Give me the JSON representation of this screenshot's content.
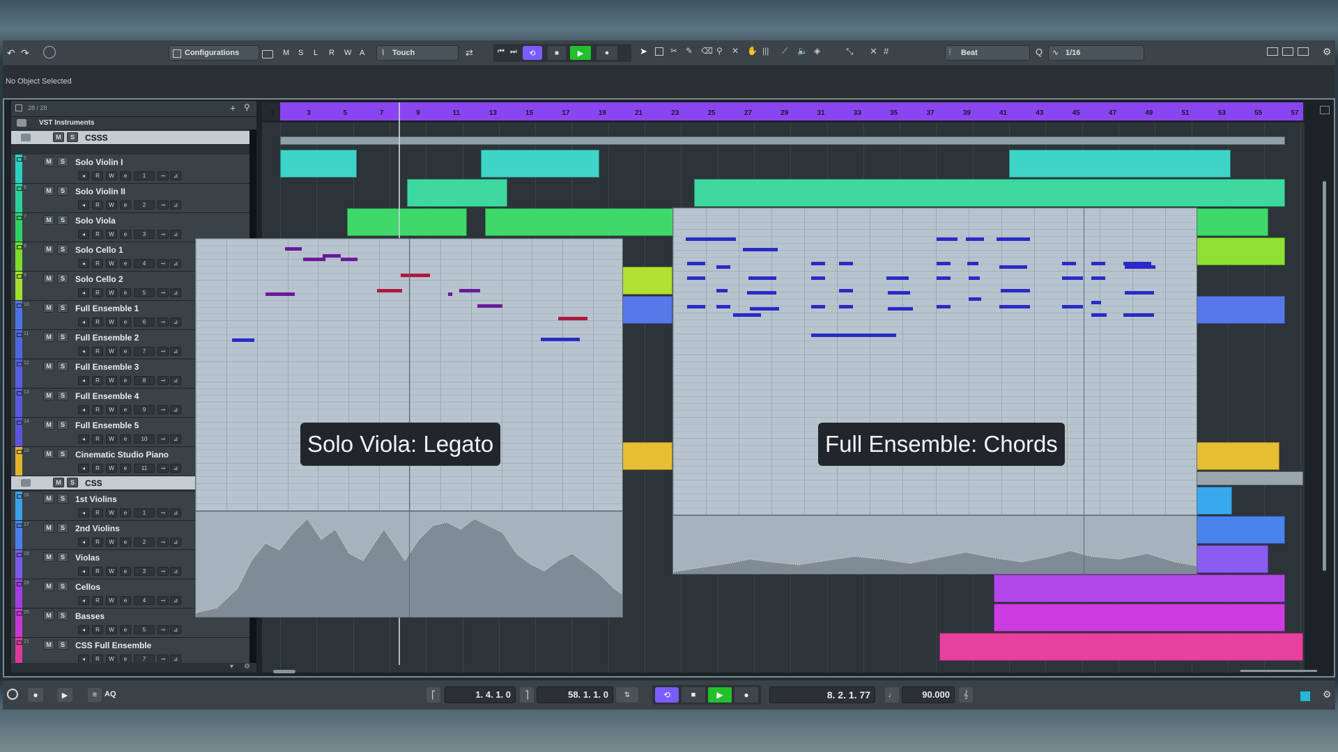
{
  "toolbar": {
    "configurations_label": "Configurations",
    "automation_mode": "Touch",
    "mode_buttons": [
      "M",
      "S",
      "L",
      "R",
      "W",
      "A"
    ],
    "grid_type": "Beat",
    "quantize": "1/16"
  },
  "info_line": {
    "text": "No Object Selected"
  },
  "track_list": {
    "count": "28 / 28",
    "folder_title": "VST Instruments",
    "tracks": [
      {
        "num": "",
        "name": "CSSS",
        "color": "#9ca7ae",
        "channel": ""
      },
      {
        "num": "5",
        "name": "Solo Violin I",
        "color": "#2ccfc0",
        "channel": "1"
      },
      {
        "num": "6",
        "name": "Solo Violin II",
        "color": "#2ccf9a",
        "channel": "2"
      },
      {
        "num": "7",
        "name": "Solo Viola",
        "color": "#2fd262",
        "channel": "3"
      },
      {
        "num": "8",
        "name": "Solo Cello 1",
        "color": "#7bdc2c",
        "channel": "4"
      },
      {
        "num": "9",
        "name": "Solo Cello 2",
        "color": "#a7dd2c",
        "channel": "5"
      },
      {
        "num": "10",
        "name": "Full Ensemble 1",
        "color": "#4e74e0",
        "channel": "6"
      },
      {
        "num": "11",
        "name": "Full Ensemble 2",
        "color": "#4e66e0",
        "channel": "7"
      },
      {
        "num": "12",
        "name": "Full Ensemble 3",
        "color": "#5660df",
        "channel": "8"
      },
      {
        "num": "13",
        "name": "Full Ensemble 4",
        "color": "#5a58de",
        "channel": "9"
      },
      {
        "num": "14",
        "name": "Full Ensemble 5",
        "color": "#5c55dc",
        "channel": "10"
      },
      {
        "num": "15",
        "name": "Cinematic Studio Piano",
        "color": "#e0b42c",
        "channel": "11"
      },
      {
        "num": "",
        "name": "CSS",
        "color": "#9ca7ae",
        "channel": ""
      },
      {
        "num": "16",
        "name": "1st Violins",
        "color": "#3aa0e8",
        "channel": "1"
      },
      {
        "num": "17",
        "name": "2nd Violins",
        "color": "#4a7fe8",
        "channel": "2"
      },
      {
        "num": "18",
        "name": "Violas",
        "color": "#7a5ae8",
        "channel": "3"
      },
      {
        "num": "19",
        "name": "Cellos",
        "color": "#a33ee0",
        "channel": "4"
      },
      {
        "num": "20",
        "name": "Basses",
        "color": "#c438d8",
        "channel": "5"
      },
      {
        "num": "21",
        "name": "CSS Full Ensemble",
        "color": "#e0389a",
        "channel": "7"
      }
    ]
  },
  "ruler": {
    "bars": [
      "1",
      "3",
      "5",
      "7",
      "9",
      "11",
      "13",
      "15",
      "17",
      "19",
      "21",
      "23",
      "25",
      "27",
      "29",
      "31",
      "33",
      "35",
      "37",
      "39",
      "41",
      "43",
      "45",
      "47",
      "49",
      "51",
      "53",
      "55",
      "57"
    ]
  },
  "overlays": {
    "left_label": "Solo Viola: Legato",
    "right_label": "Full Ensemble: Chords"
  },
  "transport": {
    "left_locator": "1. 4. 1.   0",
    "right_locator": "58. 1. 1.   0",
    "position": "8. 2. 1.  77",
    "tempo": "90.000",
    "aq_label": "AQ"
  },
  "colors": {
    "ruler": "#8b45f0",
    "editor_bg": "#b7c3cd",
    "note_purple": "#6a1a9a",
    "note_red": "#b01840",
    "note_blue": "#2a2ac8",
    "transport_play": "#22c02a"
  }
}
